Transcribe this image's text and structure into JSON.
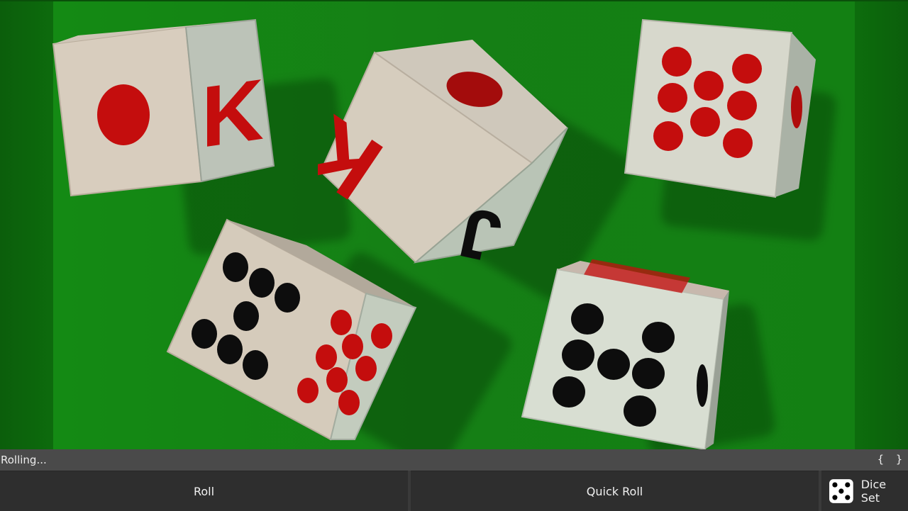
{
  "status": {
    "text": "Rolling...",
    "braces": "{ }"
  },
  "buttons": {
    "roll": "Roll",
    "quick_roll": "Quick Roll",
    "dice_set": "Dice Set"
  },
  "table": {
    "felt_color": "#148a14",
    "pip_red": "#c40d0d",
    "pip_black": "#0d0d0d"
  },
  "dice": [
    {
      "visible_faces": [
        "one",
        "K"
      ]
    },
    {
      "visible_faces": [
        "one",
        "K",
        "J"
      ]
    },
    {
      "visible_faces": [
        "eight"
      ]
    },
    {
      "visible_faces": [
        "eight",
        "eight"
      ]
    },
    {
      "visible_faces": [
        "eight"
      ]
    }
  ]
}
